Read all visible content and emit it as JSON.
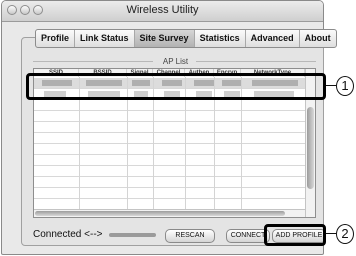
{
  "window": {
    "title": "Wireless Utility"
  },
  "tabs": [
    "Profile",
    "Link Status",
    "Site Survey",
    "Statistics",
    "Advanced",
    "About"
  ],
  "active_tab": "Site Survey",
  "ap_list": {
    "label": "AP List",
    "columns": [
      "SSID",
      "BSSID",
      "Signal",
      "Channel",
      "Authen",
      "Encryp",
      "NetworkType"
    ]
  },
  "status": {
    "text": "Connected <-->"
  },
  "buttons": {
    "rescan": "RESCAN",
    "connect": "CONNECT",
    "add_profile": "ADD PROFILE"
  },
  "callouts": [
    "1",
    "2"
  ]
}
